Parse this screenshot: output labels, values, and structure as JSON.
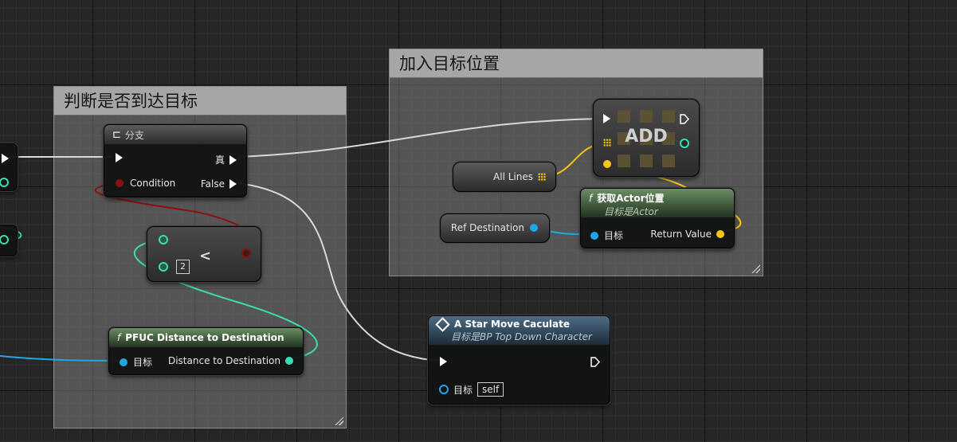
{
  "comments": {
    "reach_target": {
      "title": "判断是否到达目标"
    },
    "add_position": {
      "title": "加入目标位置"
    }
  },
  "branch": {
    "title": "分支",
    "true_label": "真",
    "false_label": "False",
    "condition_label": "Condition"
  },
  "compare": {
    "operator": "<",
    "value": "2"
  },
  "pfuc": {
    "title": "PFUC Distance to Destination",
    "target_label": "目标",
    "output_label": "Distance to Destination",
    "func_glyph": "f"
  },
  "astar": {
    "title": "A Star Move Caculate",
    "subtitle": "目标是BP Top Down Character",
    "target_label": "目标",
    "self_label": "self"
  },
  "add": {
    "title": "ADD"
  },
  "all_lines": {
    "label": "All Lines"
  },
  "ref_dest": {
    "label": "Ref Destination"
  },
  "get_actor": {
    "title": "获取Actor位置",
    "subtitle": "目标是Actor",
    "target_label": "目标",
    "return_label": "Return Value",
    "func_glyph": "f"
  },
  "colors": {
    "exec": "#ffffff",
    "bool": "#8c1010",
    "float": "#3ddbb0",
    "object": "#1ea7e6",
    "vector": "#f5c518"
  }
}
